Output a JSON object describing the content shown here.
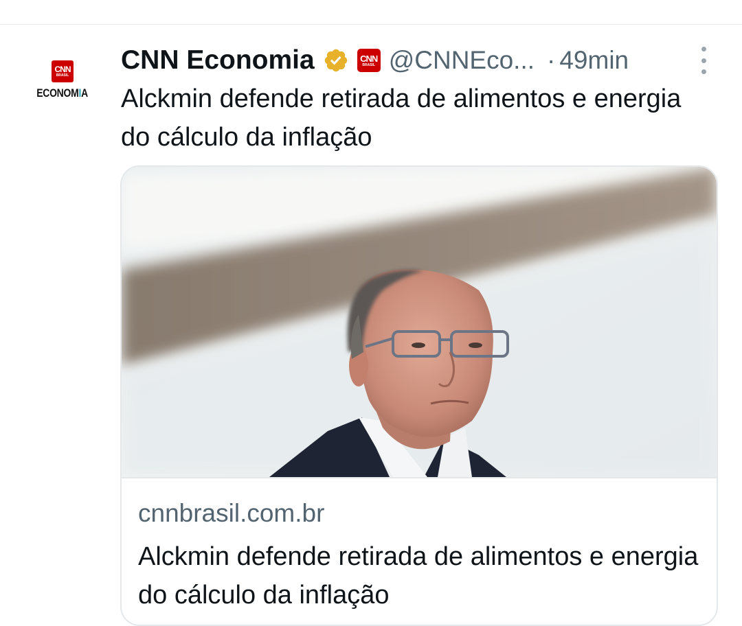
{
  "tweet": {
    "author_name": "CNN Economia",
    "handle": "@CNNEco...",
    "separator": "·",
    "time": "49min",
    "text": "Alckmin defende retirada de alimentos e energia do cálculo da inflação",
    "avatar": {
      "logo_text": "CNN",
      "logo_subtext": "BRASIL",
      "label_main": "ECONOM",
      "label_accent": "I",
      "label_end": "A"
    },
    "affiliate_badge": {
      "logo_text": "CNN",
      "logo_subtext": "BRASIL"
    },
    "icons": {
      "verified": "verified-badge-icon",
      "more": "more-options-icon"
    }
  },
  "link_card": {
    "domain": "cnnbrasil.com.br",
    "title": "Alckmin defende retirada de alimentos e energia do cálculo da inflação"
  },
  "colors": {
    "brand_red": "#cc0000",
    "verified_gold": "#e8b12a",
    "secondary_text": "#536471",
    "accent_teal": "#29a3b4"
  }
}
